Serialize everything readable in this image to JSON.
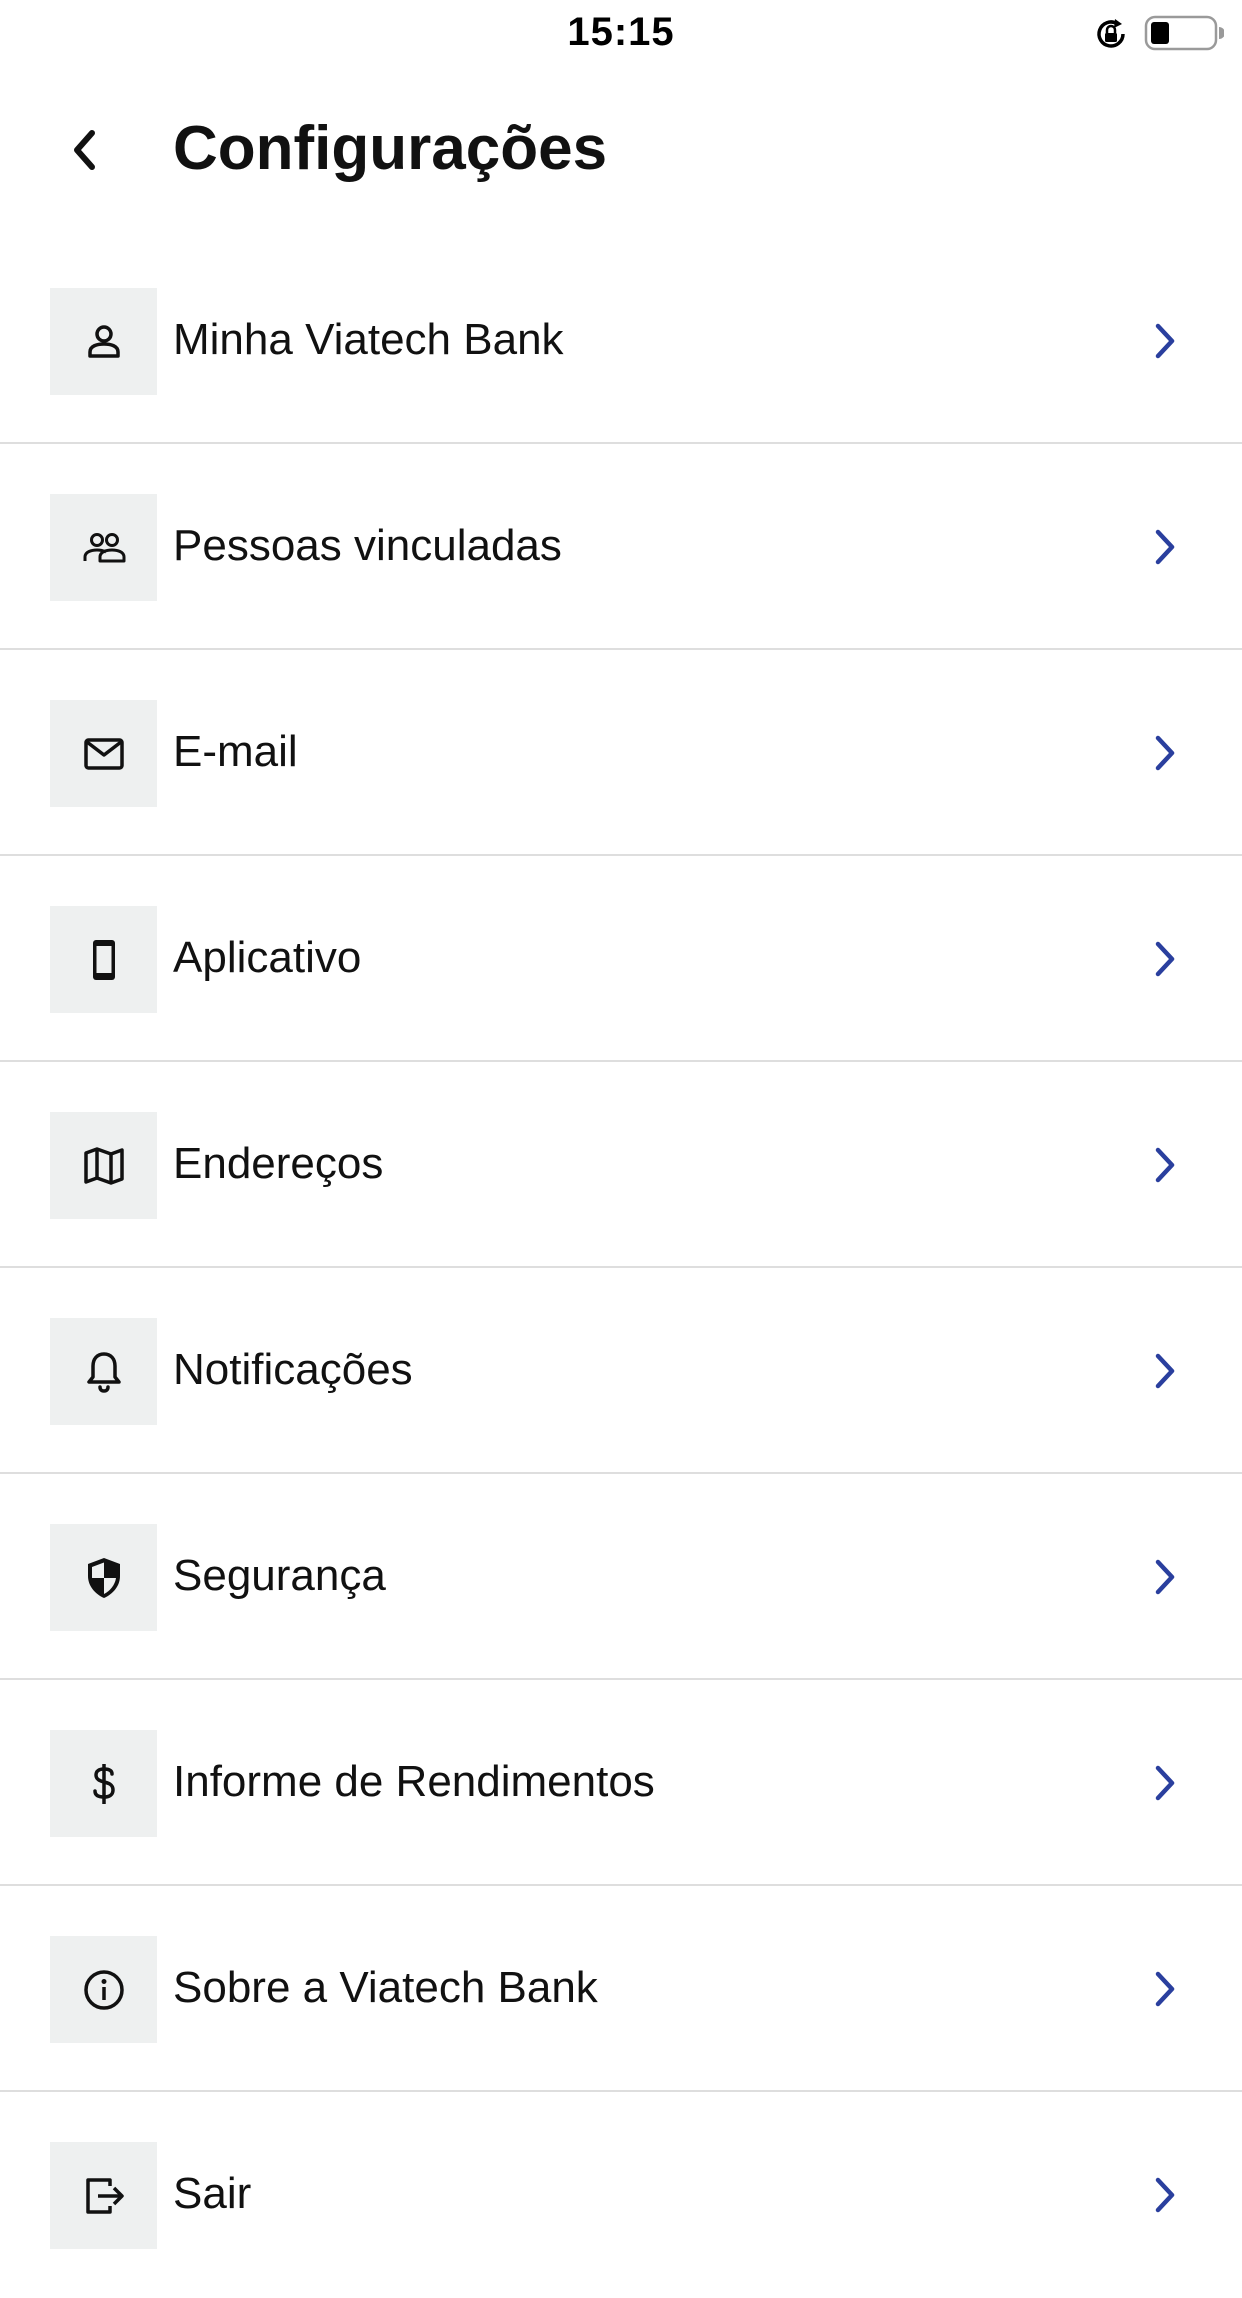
{
  "status_bar": {
    "time": "15:15",
    "icons": [
      "rotation-lock-icon",
      "battery-icon"
    ]
  },
  "header": {
    "back_icon": "chevron-left-icon",
    "title": "Configurações"
  },
  "colors": {
    "accent": "#2a3f9e",
    "icon_background": "#eef0f0",
    "divider": "#dedede",
    "text": "#111111"
  },
  "menu": {
    "items": [
      {
        "label": "Minha Viatech Bank",
        "icon": "person-icon"
      },
      {
        "label": "Pessoas vinculadas",
        "icon": "people-icon"
      },
      {
        "label": "E-mail",
        "icon": "mail-icon"
      },
      {
        "label": "Aplicativo",
        "icon": "smartphone-icon"
      },
      {
        "label": "Endereços",
        "icon": "map-icon"
      },
      {
        "label": "Notificações",
        "icon": "bell-icon"
      },
      {
        "label": "Segurança",
        "icon": "shield-icon"
      },
      {
        "label": "Informe de Rendimentos",
        "icon": "dollar-icon"
      },
      {
        "label": "Sobre a Viatech Bank",
        "icon": "info-icon"
      },
      {
        "label": "Sair",
        "icon": "logout-icon"
      }
    ]
  }
}
